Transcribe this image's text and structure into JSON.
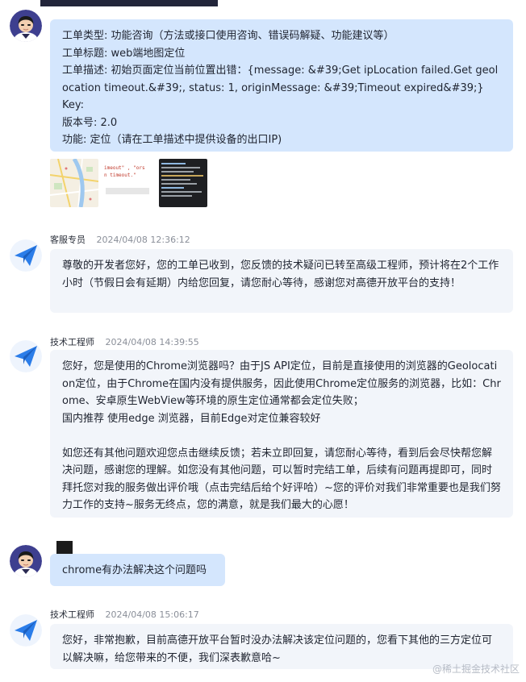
{
  "ticket": {
    "lines": [
      "工单类型: 功能咨询（方法或接口使用咨询、错误码解疑、功能建议等）",
      "工单标题: web端地图定位",
      "工单描述: 初始页面定位当前位置出错：{message: &#39;Get ipLocation failed.Get geolocation timeout.&#39;, status: 1, originMessage: &#39;Timeout expired&#39;}",
      "Key: ",
      "版本号: 2.0",
      "功能: 定位（请在工单描述中提供设备的出口IP)"
    ],
    "thumb_text": {
      "line1": "imeout\" , \"ors",
      "line2": "n timeout.\""
    }
  },
  "messages": [
    {
      "sender": "客服专员",
      "time": "2024/04/08 12:36:12",
      "paragraphs": [
        "尊敬的开发者您好，您的工单已收到，您反馈的技术疑问已转至高级工程师，预计将在2个工作小时（节假日会有延期）内给您回复，请您耐心等待，感谢您对高德开放平台的支持！"
      ]
    },
    {
      "sender": "技术工程师",
      "time": "2024/04/08 14:39:55",
      "paragraphs": [
        "您好，您是使用的Chrome浏览器吗？由于JS API定位，目前是直接使用的浏览器的Geolocation定位，由于Chrome在国内没有提供服务，因此使用Chrome定位服务的浏览器，比如：Chrome、安卓原生WebView等环境的原生定位通常都会定位失败；",
        "国内推荐 使用edge 浏览器，目前Edge对定位兼容较好",
        "",
        "如您还有其他问题欢迎您点击继续反馈；若未立即回复，请您耐心等待，看到后会尽快帮您解决问题，感谢您的理解。如您没有其他问题，可以暂时完结工单，后续有问题再提即可，同时拜托您对我的服务做出评价哦（点击完结后给个好评哈）~您的评价对我们非常重要也是我们努力工作的支持~服务无终点，您的满意，就是我们最大的心愿！"
      ]
    },
    {
      "text": "chrome有办法解决这个问题吗"
    },
    {
      "sender": "技术工程师",
      "time": "2024/04/08 15:06:17",
      "paragraphs": [
        "您好，非常抱歉，目前高德开放平台暂时没办法解决该定位问题的，您看下其他的三方定位可以解决嘛，给您带来的不便，我们深表歉意哈~"
      ]
    }
  ],
  "watermark": "@稀土掘金技术社区",
  "colors": {
    "user_bubble": "#d4e6fd",
    "agent_bubble": "#f2f5fa",
    "support_icon": "#2b7de9",
    "meta_text": "#8a8f99"
  },
  "icons": [
    "user-avatar-icon",
    "paper-plane-icon"
  ]
}
